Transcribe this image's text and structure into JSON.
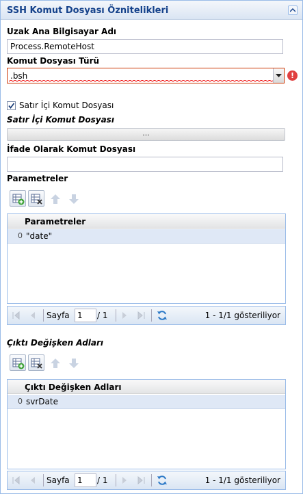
{
  "panel": {
    "title": "SSH Komut Dosyası Öznitelikleri"
  },
  "remote_host": {
    "label": "Uzak Ana Bilgisayar Adı",
    "value": "Process.RemoteHost"
  },
  "script_type": {
    "label": "Komut Dosyası Türü",
    "value": ".bsh"
  },
  "inline": {
    "checkbox_label": "Satır İçi Komut Dosyası",
    "checked": true,
    "section_label": "Satır İçi Komut Dosyası",
    "button_label": "..."
  },
  "expression": {
    "label": "İfade Olarak Komut Dosyası",
    "value": ""
  },
  "parameters": {
    "label": "Parametreler",
    "column_header": "Parametreler",
    "rows": [
      {
        "index": "0",
        "value": "\"date\""
      }
    ],
    "pager": {
      "page_label": "Sayfa",
      "page": "1",
      "of_pages": "/ 1",
      "status": "1 - 1/1 gösteriliyor"
    }
  },
  "outputs": {
    "label": "Çıktı Değişken Adları",
    "column_header": "Çıktı Değişken Adları",
    "rows": [
      {
        "index": "0",
        "value": "svrDate"
      }
    ],
    "pager": {
      "page_label": "Sayfa",
      "page": "1",
      "of_pages": "/ 1",
      "status": "1 - 1/1 gösteriliyor"
    }
  },
  "colors": {
    "accent": "#15428b",
    "border": "#99bbe8",
    "selected_row": "#dfe8f6",
    "error": "#e04040"
  }
}
